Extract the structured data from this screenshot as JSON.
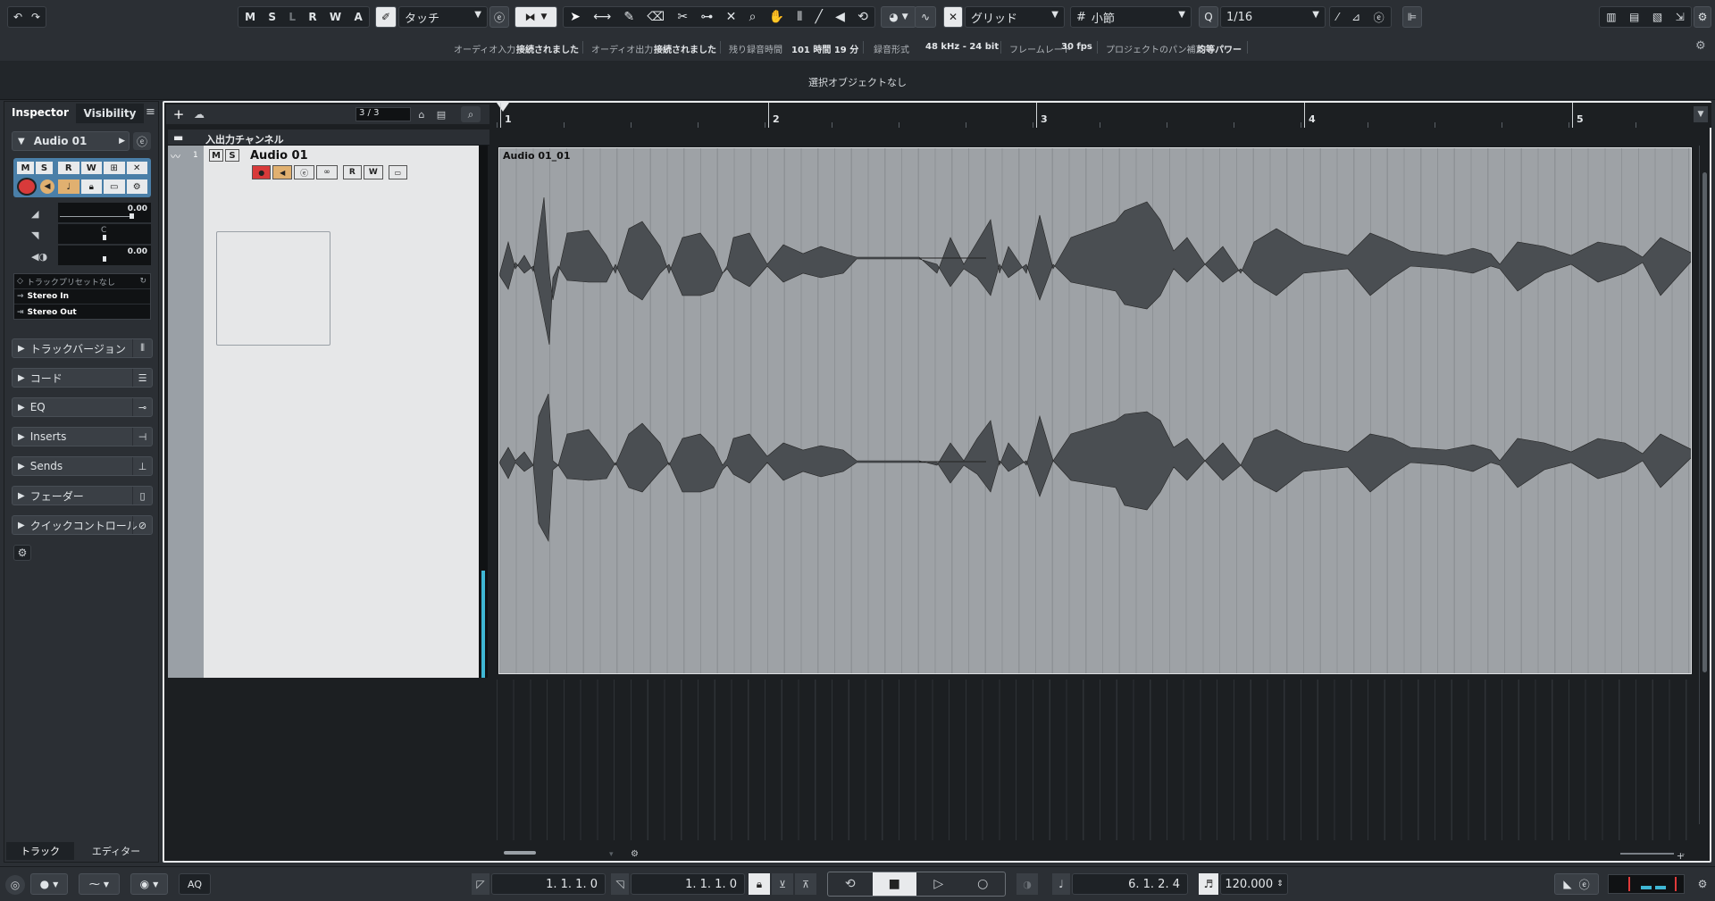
{
  "toolbar": {
    "msl": [
      "M",
      "S",
      "L",
      "R",
      "W",
      "A"
    ],
    "automation_mode": "タッチ",
    "snap_type": "グリッド",
    "grid_type": "小節",
    "quantize": "1/16"
  },
  "infobar": {
    "audio_in_label": "オーディオ入力",
    "audio_in_value": "接続されました",
    "audio_out_label": "オーディオ出力",
    "audio_out_value": "接続されました",
    "rec_time_label": "残り録音時間",
    "rec_time_value": "101 時間 19 分",
    "rec_format_label": "録音形式",
    "rec_format_value": "48 kHz - 24 bit",
    "frame_rate_label": "フレームレート",
    "frame_rate_value": "30 fps",
    "pan_label": "プロジェクトのパン補正",
    "pan_value": "均等パワー"
  },
  "selection_line": "選択オブジェクトなし",
  "inspector": {
    "tab_inspector": "Inspector",
    "tab_visibility": "Visibility",
    "track_name": "Audio 01",
    "volume_value": "0.00",
    "pan_value": "C",
    "delay_value": "0.00",
    "preset_label": "トラックプリセットなし",
    "input_routing": "Stereo In",
    "output_routing": "Stereo Out",
    "sections": [
      "トラックバージョン",
      "コード",
      "EQ",
      "Inserts",
      "Sends",
      "フェーダー",
      "クイックコントロール"
    ],
    "bottom_tab_track": "トラック",
    "bottom_tab_editor": "エディター"
  },
  "project": {
    "track_count": "3 / 3",
    "folder_name": "入出力チャンネル",
    "track_number": "1",
    "track_name": "Audio 01",
    "event_name": "Audio 01_01",
    "ruler_bars": [
      "1",
      "2",
      "3",
      "4",
      "5"
    ]
  },
  "transport": {
    "left_locator": "1. 1. 1.   0",
    "right_locator": "1. 1. 1.   0",
    "position": "6. 1. 2.   4",
    "tempo": "120.000",
    "aq_label": "AQ"
  }
}
